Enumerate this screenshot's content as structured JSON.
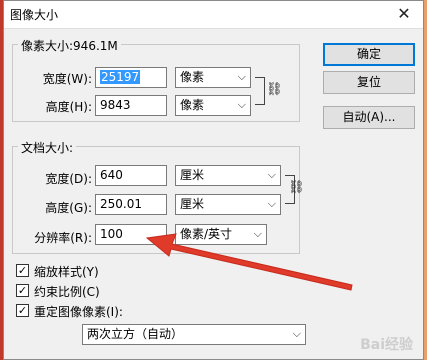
{
  "window": {
    "title": "图像大小",
    "close_icon": "close-icon"
  },
  "pixel_dimensions": {
    "legend": "像素大小:946.1M",
    "width_label": "宽度(W):",
    "width_value": "25197",
    "width_unit": "像素",
    "height_label": "高度(H):",
    "height_value": "9843",
    "height_unit": "像素"
  },
  "document_size": {
    "legend": "文档大小:",
    "width_label": "宽度(D):",
    "width_value": "640",
    "width_unit": "厘米",
    "height_label": "高度(G):",
    "height_value": "250.01",
    "height_unit": "厘米",
    "resolution_label": "分辨率(R):",
    "resolution_value": "100",
    "resolution_unit": "像素/英寸"
  },
  "buttons": {
    "ok": "确定",
    "reset": "复位",
    "auto": "自动(A)..."
  },
  "options": {
    "scale_styles": {
      "label": "缩放样式(Y)",
      "checked": true
    },
    "constrain": {
      "label": "约束比例(C)",
      "checked": true
    },
    "resample": {
      "label": "重定图像像素(I):",
      "checked": true
    },
    "resample_method": "两次立方（自动）"
  },
  "watermark": "Bai经验",
  "colors": {
    "arrow": "#e03a2a",
    "selection": "#3399ff",
    "default_button_border": "#0078d7"
  }
}
